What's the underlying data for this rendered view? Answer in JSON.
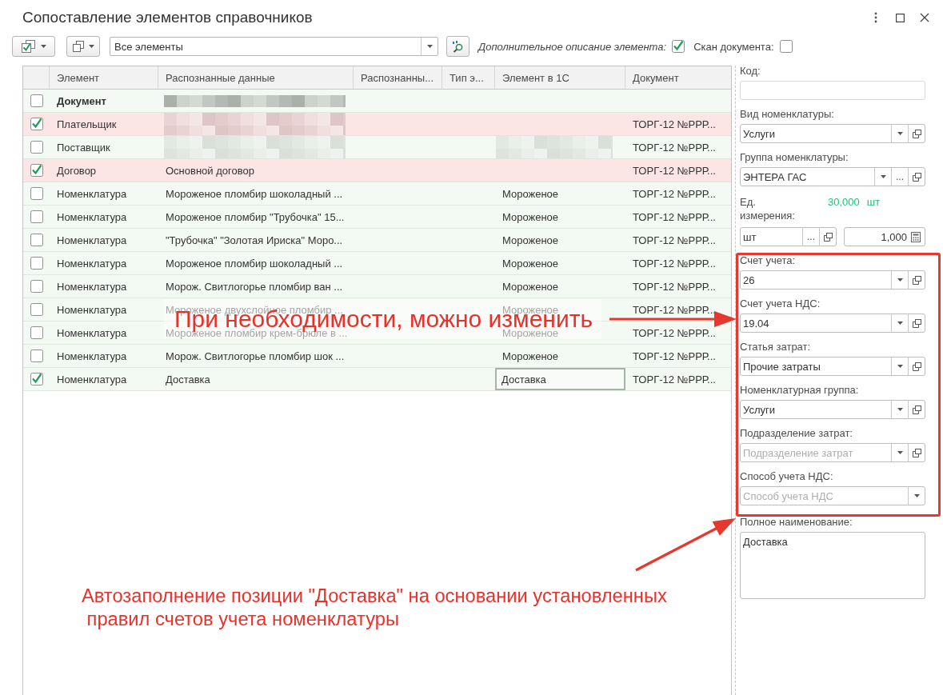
{
  "window": {
    "title": "Сопоставление элементов справочников"
  },
  "toolbar": {
    "filter": {
      "value": "Все элементы"
    },
    "options": [
      {
        "label": "Дополнительное описание элемента:",
        "italic": true,
        "checked": true
      },
      {
        "label": "Скан документа:",
        "italic": false,
        "checked": false
      }
    ]
  },
  "table": {
    "columns": [
      "Элемент",
      "Распознанные данные",
      "Распознанны...",
      "Тип э...",
      "Элемент в 1С",
      "Документ"
    ],
    "rows": [
      {
        "kind": "document",
        "checked": false,
        "highlighted": false,
        "selected": false,
        "element": "Документ",
        "recognized_blurred": true,
        "element_1c_blurred": false
      },
      {
        "kind": "item",
        "checked": true,
        "highlighted": true,
        "selected": false,
        "element": "Плательщик",
        "recognized_blurred": true,
        "element_1c_blurred": false,
        "document": "ТОРГ-12 №РРР..."
      },
      {
        "kind": "item",
        "checked": false,
        "highlighted": false,
        "selected": false,
        "element": "Поставщик",
        "recognized_blurred": true,
        "element_1c_blurred": true,
        "document": "ТОРГ-12 №РРР..."
      },
      {
        "kind": "item",
        "checked": true,
        "highlighted": true,
        "selected": false,
        "element": "Договор",
        "recognized": "Основной договор",
        "recognized_blurred": false,
        "element_1c_blurred": false,
        "document": "ТОРГ-12 №РРР..."
      },
      {
        "kind": "item",
        "checked": false,
        "highlighted": false,
        "selected": false,
        "element": "Номенклатура",
        "recognized": "Мороженое пломбир шоколадный ...",
        "recognized_blurred": false,
        "element_1c": "Мороженое",
        "element_1c_blurred": false,
        "document": "ТОРГ-12 №РРР..."
      },
      {
        "kind": "item",
        "checked": false,
        "highlighted": false,
        "selected": false,
        "element": "Номенклатура",
        "recognized": "Мороженое пломбир \"Трубочка\" 15...",
        "recognized_blurred": false,
        "element_1c": "Мороженое",
        "element_1c_blurred": false,
        "document": "ТОРГ-12 №РРР..."
      },
      {
        "kind": "item",
        "checked": false,
        "highlighted": false,
        "selected": false,
        "element": "Номенклатура",
        "recognized": "\"Трубочка\" \"Золотая Ириска\" Моро...",
        "recognized_blurred": false,
        "element_1c": "Мороженое",
        "element_1c_blurred": false,
        "document": "ТОРГ-12 №РРР..."
      },
      {
        "kind": "item",
        "checked": false,
        "highlighted": false,
        "selected": false,
        "element": "Номенклатура",
        "recognized": "Мороженое пломбир шоколадный ...",
        "recognized_blurred": false,
        "element_1c": "Мороженое",
        "element_1c_blurred": false,
        "document": "ТОРГ-12 №РРР..."
      },
      {
        "kind": "item",
        "checked": false,
        "highlighted": false,
        "selected": false,
        "element": "Номенклатура",
        "recognized": "Морож. Свитлогорье пломбир ван ...",
        "recognized_blurred": false,
        "element_1c": "Мороженое",
        "element_1c_blurred": false,
        "document": "ТОРГ-12 №РРР..."
      },
      {
        "kind": "item",
        "checked": false,
        "highlighted": false,
        "selected": false,
        "element": "Номенклатура",
        "recognized": "Мороженое двухслойное пломбир ...",
        "recognized_blurred": false,
        "element_1c": "Мороженое",
        "element_1c_blurred": false,
        "document": "ТОРГ-12 №РРР..."
      },
      {
        "kind": "item",
        "checked": false,
        "highlighted": false,
        "selected": false,
        "element": "Номенклатура",
        "recognized": "Мороженое пломбир крем-брюле в ...",
        "recognized_blurred": false,
        "element_1c": "Мороженое",
        "element_1c_blurred": false,
        "document": "ТОРГ-12 №РРР..."
      },
      {
        "kind": "item",
        "checked": false,
        "highlighted": false,
        "selected": false,
        "element": "Номенклатура",
        "recognized": "Морож. Свитлогорье пломбир шок ...",
        "recognized_blurred": false,
        "element_1c": "Мороженое",
        "element_1c_blurred": false,
        "document": "ТОРГ-12 №РРР..."
      },
      {
        "kind": "item",
        "checked": true,
        "highlighted": false,
        "selected": true,
        "element": "Номенклатура",
        "recognized": "Доставка",
        "recognized_blurred": false,
        "element_1c": "Доставка",
        "element_1c_blurred": false,
        "document": "ТОРГ-12 №РРР..."
      }
    ]
  },
  "details": {
    "sections": [
      {
        "framed": false,
        "fields": [
          {
            "kind": "text",
            "label": "Код:"
          },
          {
            "kind": "select",
            "label": "Вид номенклатуры:",
            "value": "Услуги",
            "open_button": true
          },
          {
            "kind": "select",
            "label": "Группа номенклатуры:",
            "value": "ЭНТЕРА ГАС",
            "choose": "...",
            "open_button": true
          },
          {
            "kind": "unit",
            "label": "Ед. измерения:",
            "quantity": "30,000",
            "quantity_unit": "шт",
            "unit_value": "шт",
            "choose": "...",
            "open_button": true,
            "factor": "1,000"
          }
        ]
      },
      {
        "framed": true,
        "fields": [
          {
            "kind": "select",
            "label": "Счет учета:",
            "value": "26",
            "open_button": true
          },
          {
            "kind": "select",
            "label": "Счет учета НДС:",
            "value": "19.04",
            "open_button": true
          },
          {
            "kind": "select",
            "label": "Статья затрат:",
            "value": "Прочие затраты",
            "open_button": true
          },
          {
            "kind": "select",
            "label": "Номенклатурная группа:",
            "value": "Услуги",
            "open_button": true
          },
          {
            "kind": "select",
            "label": "Подразделение затрат:",
            "placeholder": "Подразделение затрат",
            "open_button": true
          },
          {
            "kind": "select",
            "label": "Способ учета НДС:",
            "placeholder": "Способ учета НДС",
            "open_button": false
          }
        ]
      },
      {
        "framed": false,
        "fields": [
          {
            "kind": "textarea",
            "label": "Полное наименование:",
            "value": "Доставка"
          }
        ]
      }
    ]
  },
  "annotations": [
    {
      "kind": "callout",
      "text": "При необходимости, можно изменить"
    },
    {
      "kind": "note",
      "text": "Автозаполнение позиции \"Доставка\" на основании установленных\n правил счетов учета номенклатуры"
    }
  ]
}
